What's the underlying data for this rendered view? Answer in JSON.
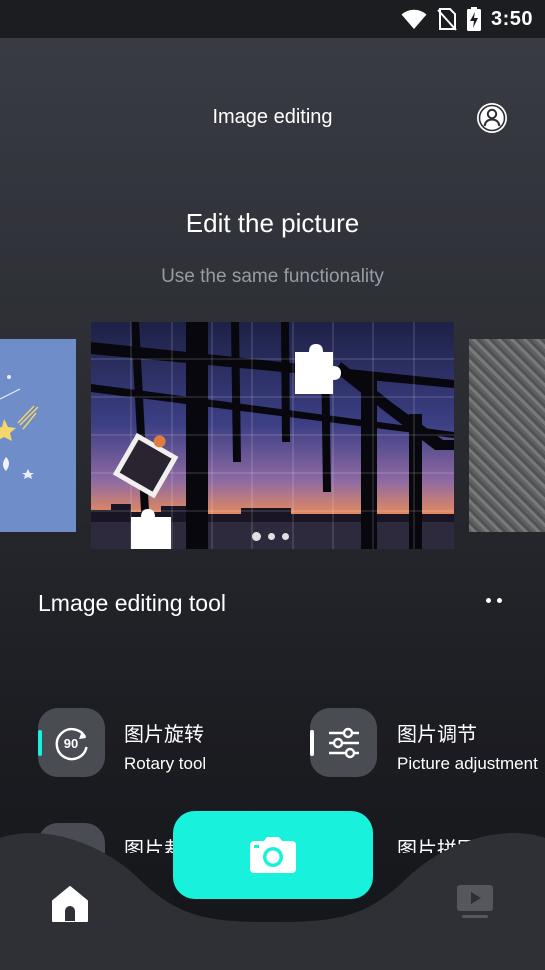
{
  "status_bar": {
    "time": "3:50"
  },
  "header": {
    "title": "Image editing"
  },
  "hero": {
    "title": "Edit the picture",
    "subtitle": "Use the same functionality"
  },
  "carousel": {
    "active_index": 0,
    "dot_count": 3
  },
  "tools_section": {
    "title": "Lmage editing tool"
  },
  "tools": [
    {
      "name": "图片旋转",
      "desc": "Rotary tool",
      "icon": "rotate-90-icon",
      "icon_text": "90",
      "accent": "#18f2dc"
    },
    {
      "name": "图片调节",
      "desc": "Picture adjustment",
      "icon": "sliders-icon",
      "accent": "#ffffff"
    },
    {
      "name": "图片裁",
      "icon": "crop-icon"
    },
    {
      "name": "图片拼图",
      "icon": "puzzle-icon"
    }
  ],
  "bottom_nav": {
    "home_icon": "home-icon",
    "camera_icon": "camera-icon",
    "video_icon": "video-icon"
  },
  "colors": {
    "accent": "#18f2dc",
    "tool_bg": "#4a4c53",
    "nav_bg": "#2e3036"
  }
}
